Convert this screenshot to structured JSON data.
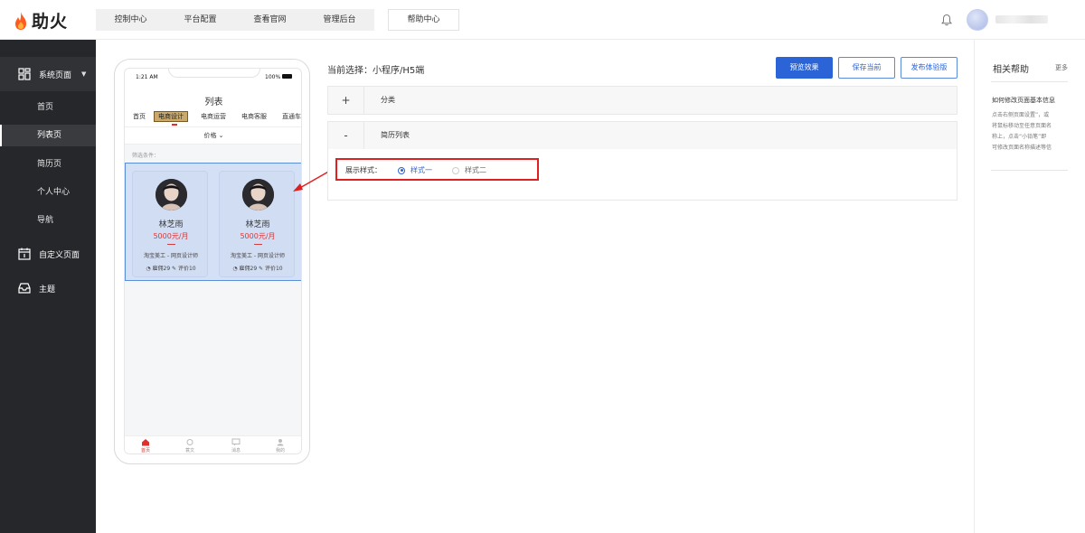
{
  "brand": {
    "name": "助火",
    "accent": "#ff5a1f"
  },
  "topnav": {
    "items": [
      "控制中心",
      "平台配置",
      "查看官网",
      "管理后台"
    ],
    "help": "帮助中心"
  },
  "sidebar": {
    "groups": [
      {
        "label": "系统页面",
        "icon": "layout-icon"
      },
      {
        "label": "自定义页面",
        "icon": "calendar-icon"
      },
      {
        "label": "主题",
        "icon": "inbox-icon"
      }
    ],
    "sub_items": [
      "首页",
      "列表页",
      "简历页",
      "个人中心",
      "导航"
    ]
  },
  "phone": {
    "time": "1:21 AM",
    "battery": "100%",
    "title": "列表",
    "tabs": [
      "首页",
      "电商设计",
      "电商运营",
      "电商客服",
      "直通车"
    ],
    "filter": "价格 ⌄",
    "filter_label": "筛选条件：",
    "cards": [
      {
        "name": "林芝雨",
        "salary": "5000元/月",
        "job": "淘宝美工 - 网页设计师",
        "meta": "◔ 雇佣29  ✎ 评价10"
      },
      {
        "name": "林芝雨",
        "salary": "5000元/月",
        "job": "淘宝美工 - 网页设计师",
        "meta": "◔ 雇佣29  ✎ 评价10"
      }
    ],
    "tabbar": [
      "首页",
      "蓑文",
      "消息",
      "我的"
    ]
  },
  "main": {
    "current_selection": "当前选择：小程序/H5端",
    "buttons": {
      "preview": "预览效果",
      "save": "保存当前",
      "publish": "发布体验版"
    },
    "panels": [
      {
        "toggle": "+",
        "title": "分类"
      },
      {
        "toggle": "-",
        "title": "简历列表"
      }
    ],
    "style_label": "展示样式：",
    "style_options": [
      "样式一",
      "样式二"
    ],
    "style_selected": "样式一"
  },
  "help": {
    "title": "相关帮助",
    "more": "更多",
    "question": "如何修改页面基本信息",
    "answer_lines": [
      "点击右侧页面设置”，或",
      "将鼠标移动至任意页面名",
      "称上，点击“小铅笔”即",
      "可修改页面名称描述等信"
    ]
  }
}
